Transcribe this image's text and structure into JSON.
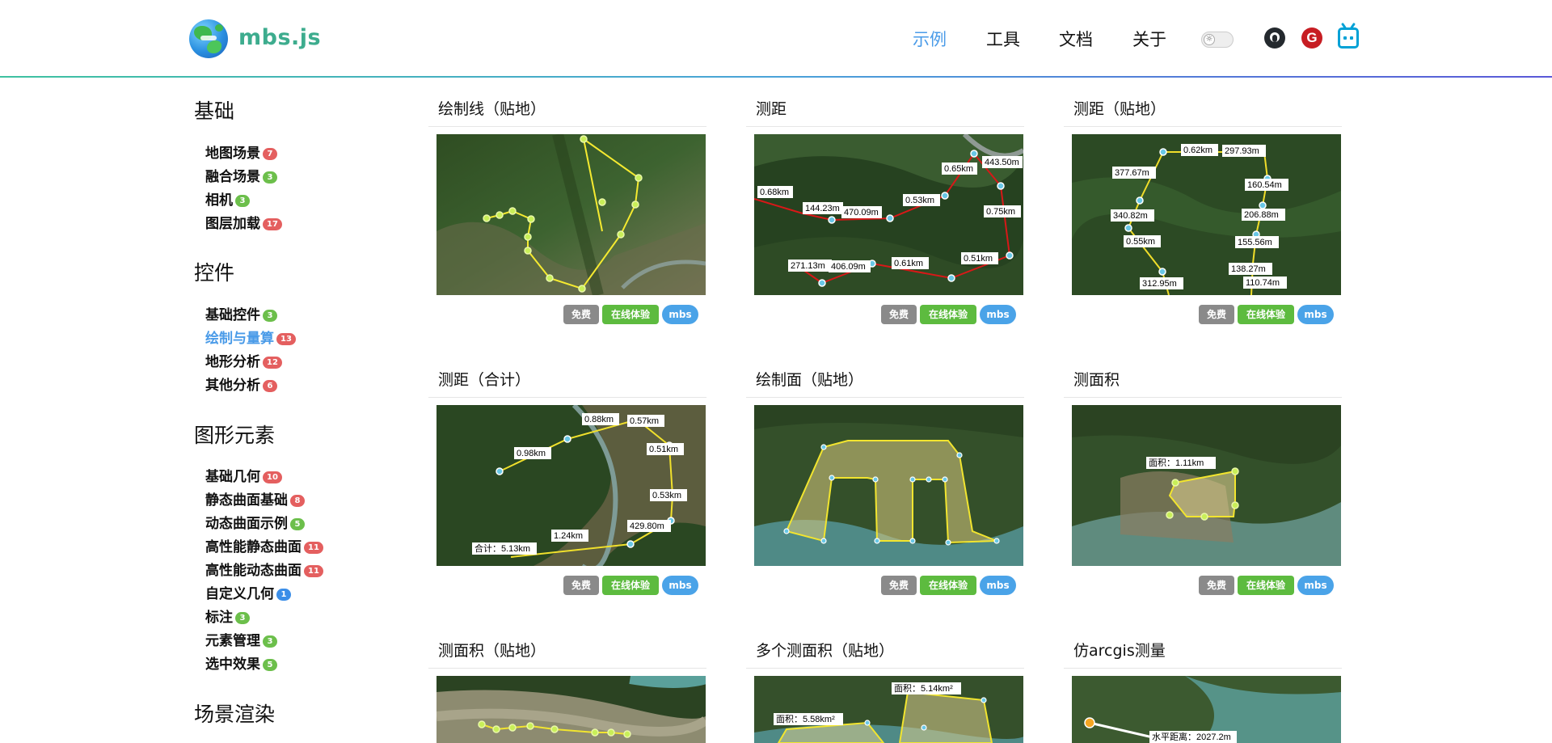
{
  "header": {
    "brand": "mbs.js",
    "nav": [
      {
        "label": "示例",
        "active": true
      },
      {
        "label": "工具",
        "active": false
      },
      {
        "label": "文档",
        "active": false
      },
      {
        "label": "关于",
        "active": false
      }
    ],
    "theme_icon": "sun-icon",
    "gitee_letter": "G",
    "accent_color": "#4a9be8",
    "brand_color": "#3dac8e"
  },
  "sidebar": {
    "sections": [
      {
        "title": "基础",
        "items": [
          {
            "label": "地图场景",
            "count": "7",
            "color": "red"
          },
          {
            "label": "融合场景",
            "count": "3",
            "color": "green"
          },
          {
            "label": "相机",
            "count": "3",
            "color": "green"
          },
          {
            "label": "图层加载",
            "count": "17",
            "color": "red"
          }
        ]
      },
      {
        "title": "控件",
        "items": [
          {
            "label": "基础控件",
            "count": "3",
            "color": "green"
          },
          {
            "label": "绘制与量算",
            "count": "13",
            "color": "red",
            "active": true
          },
          {
            "label": "地形分析",
            "count": "12",
            "color": "red"
          },
          {
            "label": "其他分析",
            "count": "6",
            "color": "red"
          }
        ]
      },
      {
        "title": "图形元素",
        "items": [
          {
            "label": "基础几何",
            "count": "10",
            "color": "red"
          },
          {
            "label": "静态曲面基础",
            "count": "8",
            "color": "red"
          },
          {
            "label": "动态曲面示例",
            "count": "5",
            "color": "green"
          },
          {
            "label": "高性能静态曲面",
            "count": "11",
            "color": "red"
          },
          {
            "label": "高性能动态曲面",
            "count": "11",
            "color": "red"
          },
          {
            "label": "自定义几何",
            "count": "1",
            "color": "blue"
          },
          {
            "label": "标注",
            "count": "3",
            "color": "green"
          },
          {
            "label": "元素管理",
            "count": "3",
            "color": "green"
          },
          {
            "label": "选中效果",
            "count": "5",
            "color": "green"
          }
        ]
      },
      {
        "title": "场景渲染",
        "items": []
      }
    ]
  },
  "tags": {
    "free": "免费",
    "online": "在线体验",
    "mbs": "mbs"
  },
  "cards": [
    {
      "title": "绘制线（贴地）",
      "labels": []
    },
    {
      "title": "测距",
      "labels": [
        "443.50m",
        "0.65km",
        "0.68km",
        "144.23m",
        "470.09m",
        "0.53km",
        "0.75km",
        "271.13m",
        "406.09m",
        "0.61km",
        "0.51km"
      ]
    },
    {
      "title": "测距（贴地）",
      "labels": [
        "0.62km",
        "297.93m",
        "377.67m",
        "160.54m",
        "340.82m",
        "206.88m",
        "0.55km",
        "155.56m",
        "138.27m",
        "312.95m",
        "110.74m"
      ]
    },
    {
      "title": "测距（合计）",
      "labels": [
        "0.88km",
        "0.57km",
        "0.51km",
        "0.98km",
        "0.53km",
        "429.80m",
        "1.24km",
        "合计：5.13km"
      ]
    },
    {
      "title": "绘制面（贴地）",
      "labels": []
    },
    {
      "title": "测面积",
      "labels": [
        "面积：1.11km"
      ]
    },
    {
      "title": "测面积（贴地）",
      "labels": []
    },
    {
      "title": "多个测面积（贴地）",
      "labels": [
        "面积：5.14km²",
        "面积：5.58km²"
      ]
    },
    {
      "title": "仿arcgis测量",
      "labels": [
        "水平距离：2027.2m"
      ]
    }
  ]
}
